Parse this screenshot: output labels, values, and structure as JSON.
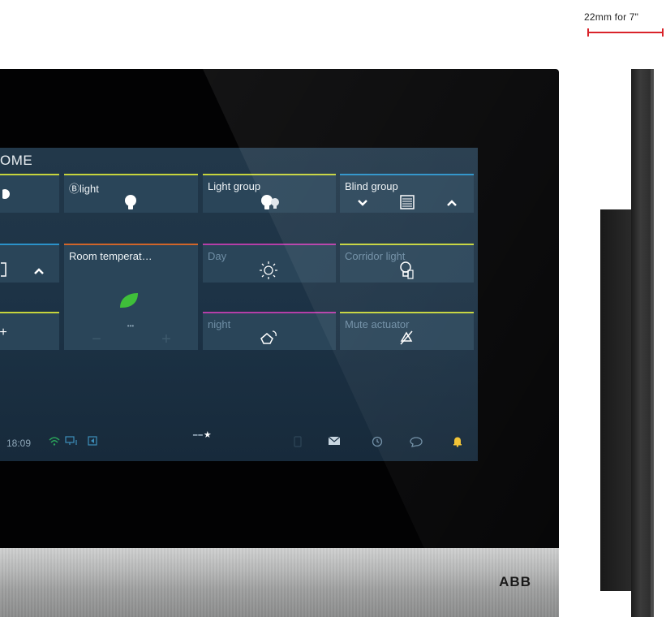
{
  "dimension": {
    "label": "22mm for 7\""
  },
  "brand": {
    "logo": "ABB"
  },
  "screen": {
    "title": "OME",
    "tiles": [
      {
        "id": "tile-0-0",
        "label": "",
        "icon": "bulb-icon"
      },
      {
        "id": "tile-0-1",
        "label": "Ⓑlight",
        "icon": "bulb-icon"
      },
      {
        "id": "tile-0-2",
        "label": "Light group",
        "icon": "bulbs-icon"
      },
      {
        "id": "tile-0-3",
        "label": "Blind group",
        "icon": "blind-icon"
      },
      {
        "id": "tile-1-0",
        "label": "",
        "icon": "blind-icon"
      },
      {
        "id": "tile-1-1",
        "label": "Room temperat…",
        "icon": "leaf-icon"
      },
      {
        "id": "tile-1-2",
        "label": "Day",
        "icon": "sun-icon"
      },
      {
        "id": "tile-1-3",
        "label": "Corridor light",
        "icon": "corridor-light-icon"
      },
      {
        "id": "tile-2-0",
        "label": "",
        "icon": "plus-icon"
      },
      {
        "id": "tile-2-2",
        "label": "night",
        "icon": "moon-icon"
      },
      {
        "id": "tile-2-3",
        "label": "Mute actuator",
        "icon": "mute-icon"
      }
    ],
    "room_temp_controls": {
      "minus": "−",
      "plus": "+",
      "dots": "•••"
    },
    "statusbar": {
      "time": "18:09",
      "page_dots": "━━",
      "page_star": "★"
    }
  },
  "colors": {
    "lime": "#c6d43c",
    "blue": "#2b92c9",
    "orange": "#d0652a",
    "magenta": "#b53ea8",
    "leaf": "#3fbf3a",
    "status_bell": "#f2c230"
  }
}
